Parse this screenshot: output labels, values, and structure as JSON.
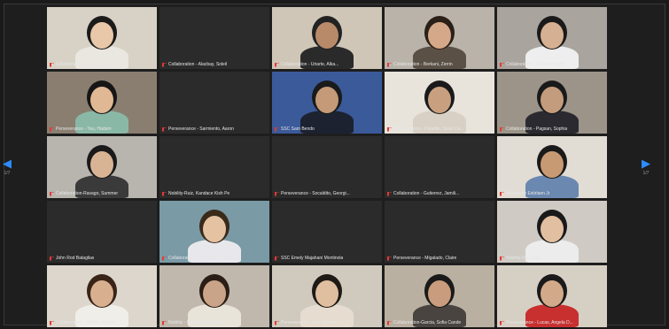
{
  "navigation": {
    "prev_arrow": "◀",
    "next_arrow": "▶",
    "page_left": "1/7",
    "page_right": "1/7"
  },
  "tiles": [
    {
      "name": "Collaboration - Cheng, Ayumi",
      "video": true,
      "bg": "#d8d2c6",
      "skin": "#e8c8a8",
      "hair": "#1b1b1b",
      "shirt": "#eae6e0"
    },
    {
      "name": "Collaboration - Alacbay, Soleil",
      "video": false
    },
    {
      "name": "Collaboration - Uriarte, Alka...",
      "video": true,
      "bg": "#cfc6b8",
      "skin": "#b88a6a",
      "hair": "#222",
      "shirt": "#2a2a2a"
    },
    {
      "name": "Collaboration - Berkani, Zerrin",
      "video": true,
      "bg": "#b9b3aa",
      "skin": "#d4a888",
      "hair": "#2a2018",
      "shirt": "#5a5046"
    },
    {
      "name": "Collaboration - Zulueta, Ingrid",
      "video": true,
      "bg": "#a9a49e",
      "skin": "#d6b092",
      "hair": "#1a1a1a",
      "shirt": "#eee"
    },
    {
      "name": "Perseverance - Yau, Hadam",
      "video": true,
      "bg": "#8a7e70",
      "skin": "#e0b894",
      "hair": "#161616",
      "shirt": "#8ab8a6"
    },
    {
      "name": "Perseverance - Sarmiento, Aaron",
      "video": false
    },
    {
      "name": "SSC Sam Bendo",
      "video": true,
      "bg": "#3a5a9a",
      "skin": "#c49a78",
      "hair": "#1a1a1a",
      "shirt": "#1c2230"
    },
    {
      "name": "Perseverance - Pajarillo, Sean Ca...",
      "video": true,
      "bg": "#e8e4dc",
      "skin": "#c8a080",
      "hair": "#1a1a1a",
      "shirt": "#d8d0c4"
    },
    {
      "name": "Collaboration - Pagsan, Sophia",
      "video": true,
      "bg": "#9c9488",
      "skin": "#c29c7c",
      "hair": "#1a1a1a",
      "shirt": "#2a2a30"
    },
    {
      "name": "Collaboration-Ravago, Summer",
      "video": true,
      "bg": "#b8b4ae",
      "skin": "#d8b494",
      "hair": "#1a1a1a",
      "shirt": "#3a3a3a"
    },
    {
      "name": "Nobility-Ruiz, Kandace Kish Pe",
      "video": false
    },
    {
      "name": "Perseverance - Socaldito, Georgi...",
      "video": false
    },
    {
      "name": "Collaboration - Gutierrez, Jamili...",
      "video": false
    },
    {
      "name": "Humphrey Estirlaen Jr",
      "video": true,
      "bg": "#e2ddd4",
      "skin": "#c89a74",
      "hair": "#1a1a1a",
      "shirt": "#6a88b0"
    },
    {
      "name": "John Rod Bataglias",
      "video": false
    },
    {
      "name": "Collaboration - Lim, Aaron Reig",
      "video": true,
      "bg": "#7a9aa6",
      "skin": "#e4c2a2",
      "hair": "#3a2a1a",
      "shirt": "#e8e8ec"
    },
    {
      "name": "SSC Emely Majahani Montinola",
      "video": false
    },
    {
      "name": "Perseverance - Migalado, Claire",
      "video": false
    },
    {
      "name": "Nobility-Sy, Elijah",
      "video": true,
      "bg": "#cfcac4",
      "skin": "#e2bfa0",
      "hair": "#1a1a1a",
      "shirt": "#ececec"
    },
    {
      "name": "Collaboration - Olhalra, Alyssa",
      "video": true,
      "bg": "#dcd6cc",
      "skin": "#d8b090",
      "hair": "#3a2418",
      "shirt": "#f0eee8"
    },
    {
      "name": "Nobility - Hanifa, Irene Hartha",
      "video": true,
      "bg": "#c0b8ac",
      "skin": "#caa488",
      "hair": "#2a1e16",
      "shirt": "#e8e4da"
    },
    {
      "name": "Perseverance - Lee, Guirhai",
      "video": true,
      "bg": "#d0cabe",
      "skin": "#e0bea0",
      "hair": "#1e1a16",
      "shirt": "#e6dccf"
    },
    {
      "name": "Collaboration-Garcia, Sofia Cande",
      "video": true,
      "bg": "#bab0a2",
      "skin": "#c89c7c",
      "hair": "#1a1a1a",
      "shirt": "#4a4440"
    },
    {
      "name": "Perseverance - Lucas, Angela D...",
      "video": true,
      "bg": "#d6cfc4",
      "skin": "#d2aa8a",
      "hair": "#1a1a1a",
      "shirt": "#c83030"
    }
  ]
}
